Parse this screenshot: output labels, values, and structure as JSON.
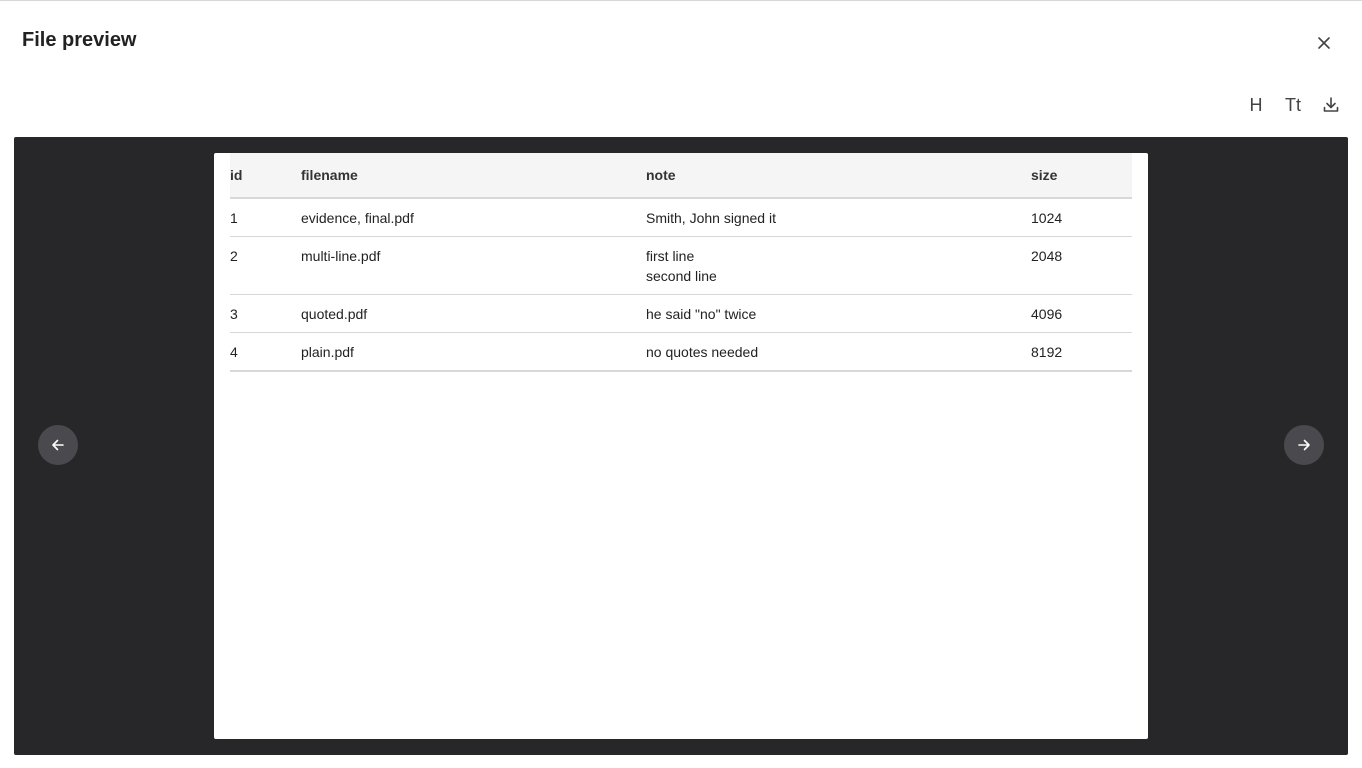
{
  "modal": {
    "title": "File preview"
  },
  "toolbar": {
    "heading_label": "H",
    "text_size_label": "Tt"
  },
  "table": {
    "headers": {
      "id": "id",
      "filename": "filename",
      "note": "note",
      "size": "size"
    },
    "rows": [
      {
        "id": "1",
        "filename": "evidence, final.pdf",
        "note": [
          "Smith, John signed it"
        ],
        "size": "1024"
      },
      {
        "id": "2",
        "filename": "multi-line.pdf",
        "note": [
          "first line",
          "second line"
        ],
        "size": "2048"
      },
      {
        "id": "3",
        "filename": "quoted.pdf",
        "note": [
          "he said \"no\" twice"
        ],
        "size": "4096"
      },
      {
        "id": "4",
        "filename": "plain.pdf",
        "note": [
          "no quotes needed"
        ],
        "size": "8192"
      }
    ]
  },
  "icons": {
    "close": "close-icon",
    "download": "download-icon",
    "prev": "arrow-left-icon",
    "next": "arrow-right-icon"
  },
  "colors": {
    "viewer_background": "#27272a",
    "nav_button": "#4a4a4e",
    "header_row": "#f5f5f5"
  }
}
